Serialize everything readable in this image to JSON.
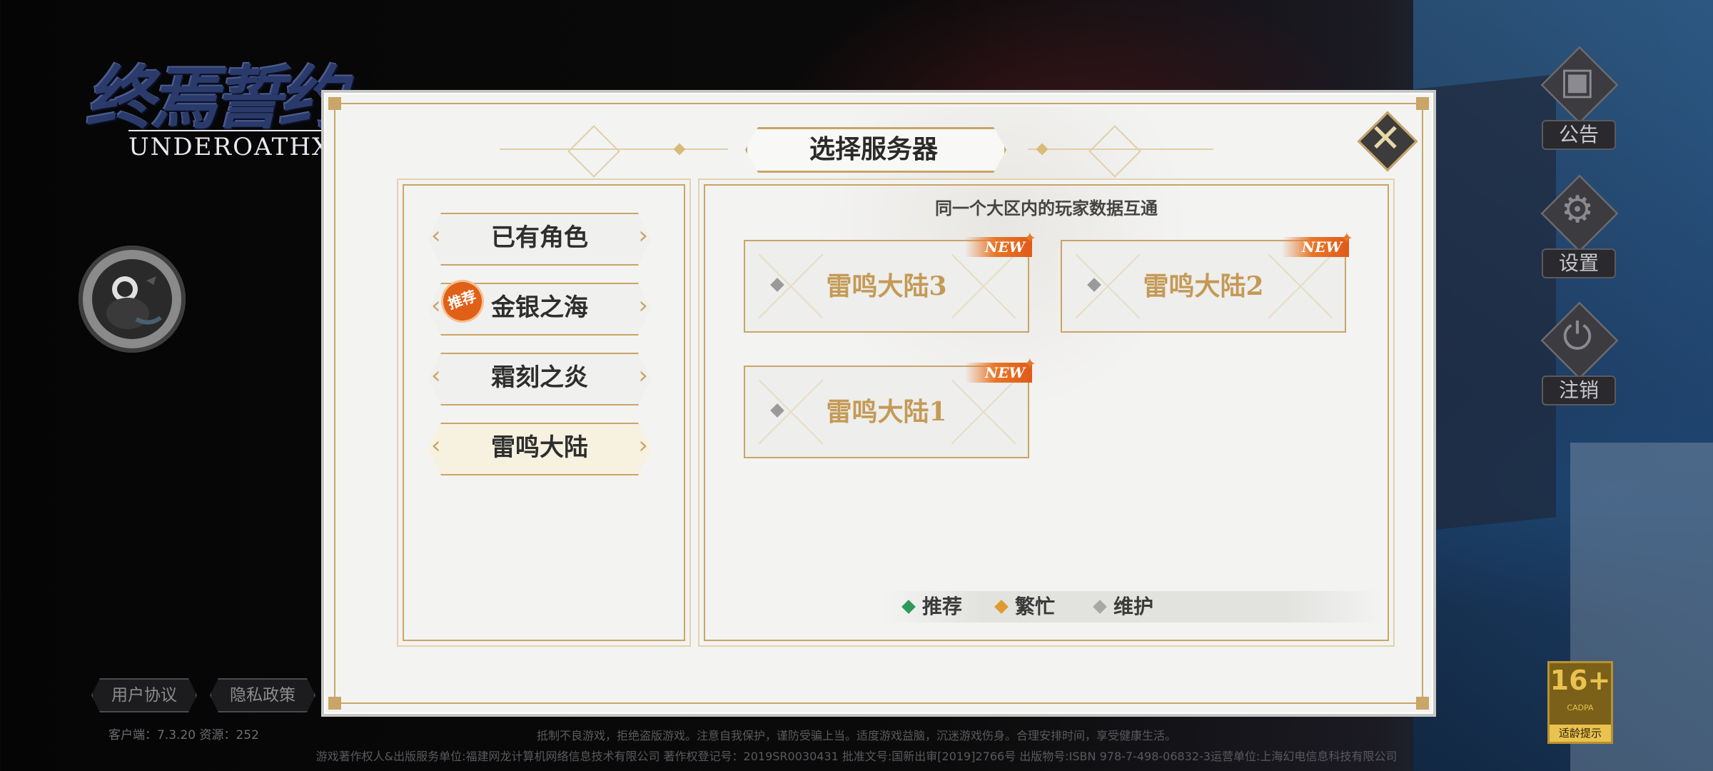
{
  "logo": {
    "title": "终焉誓约",
    "subtitle": "UNDEROATHX"
  },
  "side_menu": [
    {
      "label": "公告",
      "icon": "announcement-icon",
      "glyph": "▣"
    },
    {
      "label": "设置",
      "icon": "gear-icon",
      "glyph": "⚙"
    },
    {
      "label": "注销",
      "icon": "power-icon",
      "glyph": "⏻"
    }
  ],
  "age_badge": {
    "rating": "16+",
    "org": "CADPA",
    "text": "适龄提示"
  },
  "footer": {
    "user_agreement": "用户协议",
    "privacy_policy": "隐私政策",
    "version": "客户端：7.3.20  资源：252",
    "legal_line1": "抵制不良游戏，拒绝盗版游戏。注意自我保护，谨防受骗上当。适度游戏益脑，沉迷游戏伤身。合理安排时间，享受健康生活。",
    "legal_line2": "游戏著作权人&出版服务单位:福建网龙计算机网络信息技术有限公司  著作权登记号：2019SR0030431  批准文号:国新出审[2019]2766号  出版物号:ISBN 978-7-498-06832-3运营单位:上海幻电信息科技有限公司"
  },
  "dialog": {
    "title": "选择服务器",
    "close_glyph": "✕",
    "regions": [
      {
        "label": "已有角色",
        "recommended": false,
        "active": false
      },
      {
        "label": "金银之海",
        "recommended": true,
        "active": false
      },
      {
        "label": "霜刻之炎",
        "recommended": false,
        "active": false
      },
      {
        "label": "雷鸣大陆",
        "recommended": false,
        "active": true
      }
    ],
    "recommend_badge": "推荐",
    "subtitle": "同一个大区内的玩家数据互通",
    "servers": [
      {
        "name": "雷鸣大陆3",
        "tag": "NEW",
        "status": "maintenance"
      },
      {
        "name": "雷鸣大陆2",
        "tag": "NEW",
        "status": "maintenance"
      },
      {
        "name": "雷鸣大陆1",
        "tag": "NEW",
        "status": "maintenance"
      }
    ],
    "legend": [
      {
        "label": "推荐",
        "color": "#2e9a5a"
      },
      {
        "label": "繁忙",
        "color": "#e09a30"
      },
      {
        "label": "维护",
        "color": "#a8a8a8"
      }
    ]
  }
}
